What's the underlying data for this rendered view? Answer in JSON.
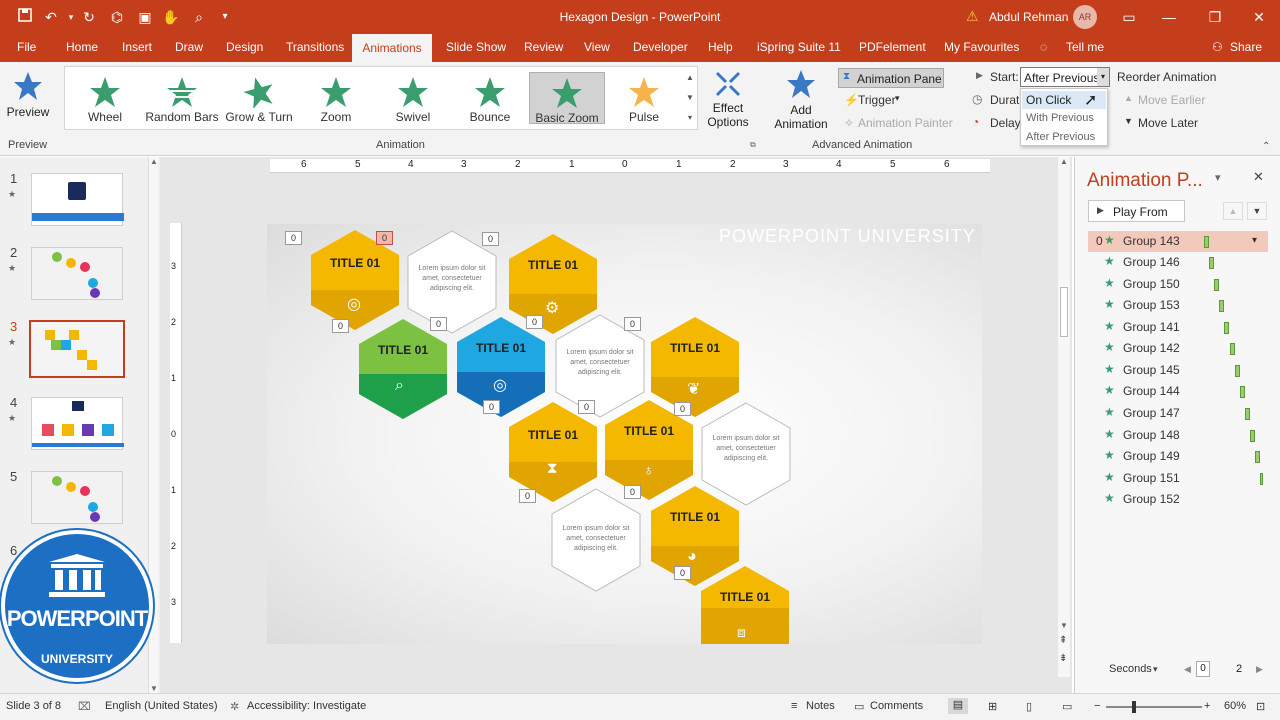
{
  "window": {
    "title": "Hexagon Design - PowerPoint",
    "user": "Abdul Rehman",
    "user_initials": "AR"
  },
  "tabs": [
    "File",
    "Home",
    "Insert",
    "Draw",
    "Design",
    "Transitions",
    "Animations",
    "Slide Show",
    "Review",
    "View",
    "Developer",
    "Help",
    "iSpring Suite 11",
    "PDFelement",
    "My Favourites",
    "Tell me",
    "Share"
  ],
  "ribbon": {
    "preview": "Preview",
    "preview_group": "Preview",
    "animations": [
      "Wheel",
      "Random Bars",
      "Grow & Turn",
      "Zoom",
      "Swivel",
      "Bounce",
      "Basic Zoom",
      "Pulse"
    ],
    "animation_group": "Animation",
    "effect_options": "Effect",
    "effect_options2": "Options",
    "add_animation": "Add",
    "add_animation2": "Animation",
    "animation_pane": "Animation Pane",
    "trigger": "Trigger",
    "animation_painter": "Animation Painter",
    "advanced_group": "Advanced Animation",
    "start_label": "Start:",
    "start_value": "After Previous",
    "duration_label": "Durati",
    "delay_label": "Delay:",
    "dropdown": [
      "On Click",
      "With Previous",
      "After Previous"
    ],
    "reorder": "Reorder Animation",
    "move_earlier": "Move Earlier",
    "move_later": "Move Later"
  },
  "slides": [
    {
      "num": "1"
    },
    {
      "num": "2"
    },
    {
      "num": "3"
    },
    {
      "num": "4"
    },
    {
      "num": "5"
    },
    {
      "num": "6"
    }
  ],
  "slide": {
    "watermark": "POWERPOINT UNIVERSITY",
    "hex_title": "TITLE 01",
    "lorem": "Lorem ipsum dolor sit amet, consectetuer adipiscing elit.",
    "tag": "0"
  },
  "logo": {
    "line1": "POWERPOINT",
    "line2": "UNIVERSITY"
  },
  "pane": {
    "title": "Animation P...",
    "play_from": "Play From",
    "first_index": "0",
    "items": [
      "Group 143",
      "Group 146",
      "Group 150",
      "Group 153",
      "Group 141",
      "Group 142",
      "Group 145",
      "Group 144",
      "Group 147",
      "Group 148",
      "Group 149",
      "Group 151",
      "Group 152"
    ],
    "seconds": "Seconds",
    "timeline_start": "0",
    "timeline_end": "2"
  },
  "status": {
    "slide": "Slide 3 of 8",
    "language": "English (United States)",
    "accessibility": "Accessibility: Investigate",
    "notes": "Notes",
    "comments": "Comments",
    "zoom": "60%"
  },
  "ruler": [
    "6",
    "5",
    "4",
    "3",
    "2",
    "1",
    "0",
    "1",
    "2",
    "3",
    "4",
    "5",
    "6"
  ],
  "vruler": [
    "3",
    "2",
    "1",
    "0",
    "1",
    "2",
    "3"
  ],
  "colors": {
    "accent": "#c43e1c",
    "yellow": "#f5b800",
    "green": "#7dc142",
    "blue": "#1ea7e1",
    "star": "#3a9d6e"
  }
}
